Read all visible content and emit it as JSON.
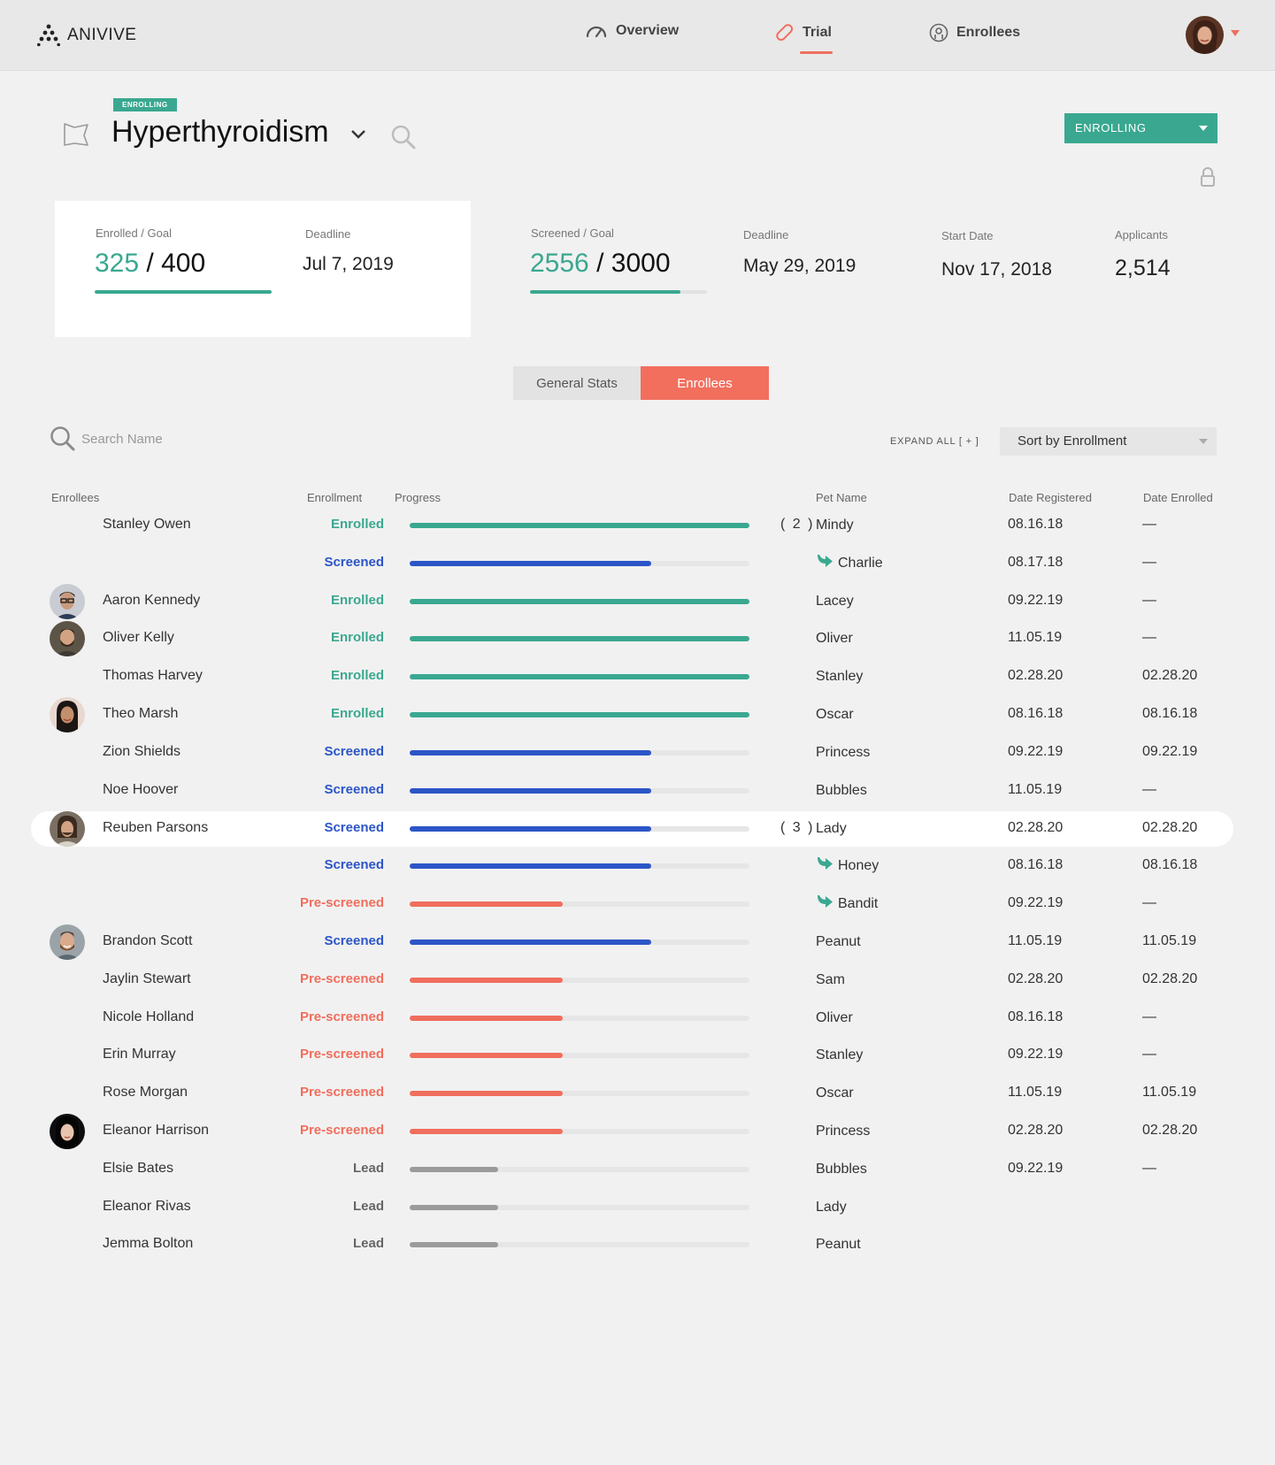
{
  "app": {
    "logo_text": "ANIVIVE"
  },
  "nav": {
    "overview": "Overview",
    "trial": "Trial",
    "enrollees": "Enrollees"
  },
  "trial": {
    "badge": "ENROLLING",
    "title": "Hyperthyroidism",
    "status_value": "ENROLLING"
  },
  "stats": {
    "enrolled_goal_label": "Enrolled / Goal",
    "enrolled": "325",
    "enrolled_goal": "400",
    "enrolled_fraction": 1.0,
    "deadline1_label": "Deadline",
    "deadline1": "Jul 7, 2019",
    "screened_goal_label": "Screened / Goal",
    "screened": "2556",
    "screened_goal": "3000",
    "screened_fraction": 0.85,
    "deadline2_label": "Deadline",
    "deadline2": "May 29, 2019",
    "start_label": "Start Date",
    "start": "Nov 17, 2018",
    "applicants_label": "Applicants",
    "applicants": "2,514"
  },
  "tabs": {
    "general": "General Stats",
    "enrollees": "Enrollees"
  },
  "toolbar": {
    "search_placeholder": "Search Name",
    "expand_all": "EXPAND ALL [ + ]",
    "sort_value": "Sort by Enrollment"
  },
  "columns": {
    "enrollees": "Enrollees",
    "enrollment": "Enrollment",
    "progress": "Progress",
    "pet": "Pet Name",
    "registered": "Date Registered",
    "enrolled": "Date Enrolled"
  },
  "colors": {
    "enrolled": "#3aa890",
    "screened": "#2c55c7",
    "prescreened": "#f06e5d",
    "lead": "#666666",
    "lead_bar": "#9b9b9b",
    "accent": "#f26f5e"
  },
  "rows": [
    {
      "name": "Stanley Owen",
      "status": "Enrolled",
      "progress": 1.0,
      "count": "( 2 )",
      "pet": "Mindy",
      "registered": "08.16.18",
      "enrolled": "—",
      "avatar": ""
    },
    {
      "name": "",
      "status": "Screened",
      "progress": 0.71,
      "count": "",
      "pet": "Charlie",
      "child": true,
      "registered": "08.17.18",
      "enrolled": "—",
      "avatar": ""
    },
    {
      "name": "Aaron Kennedy",
      "status": "Enrolled",
      "progress": 1.0,
      "count": "",
      "pet": "Lacey",
      "registered": "09.22.19",
      "enrolled": "—",
      "avatar": "man-glasses"
    },
    {
      "name": "Oliver Kelly",
      "status": "Enrolled",
      "progress": 1.0,
      "count": "",
      "pet": "Oliver",
      "registered": "11.05.19",
      "enrolled": "—",
      "avatar": "man-beard"
    },
    {
      "name": "Thomas Harvey",
      "status": "Enrolled",
      "progress": 1.0,
      "count": "",
      "pet": "Stanley",
      "registered": "02.28.20",
      "enrolled": "02.28.20",
      "avatar": ""
    },
    {
      "name": "Theo Marsh",
      "status": "Enrolled",
      "progress": 1.0,
      "count": "",
      "pet": "Oscar",
      "registered": "08.16.18",
      "enrolled": "08.16.18",
      "avatar": "woman-dark"
    },
    {
      "name": "Zion Shields",
      "status": "Screened",
      "progress": 0.71,
      "count": "",
      "pet": "Princess",
      "registered": "09.22.19",
      "enrolled": "09.22.19",
      "avatar": ""
    },
    {
      "name": "Noe Hoover",
      "status": "Screened",
      "progress": 0.71,
      "count": "",
      "pet": "Bubbles",
      "registered": "11.05.19",
      "enrolled": "—",
      "avatar": ""
    },
    {
      "name": "Reuben Parsons",
      "status": "Screened",
      "progress": 0.71,
      "count": "( 3 )",
      "pet": "Lady",
      "registered": "02.28.20",
      "enrolled": "02.28.20",
      "avatar": "man-hair",
      "highlight": true
    },
    {
      "name": "",
      "status": "Screened",
      "progress": 0.71,
      "count": "",
      "pet": "Honey",
      "child": true,
      "registered": "08.16.18",
      "enrolled": "08.16.18",
      "avatar": ""
    },
    {
      "name": "",
      "status": "Pre-screened",
      "progress": 0.45,
      "count": "",
      "pet": "Bandit",
      "child": true,
      "registered": "09.22.19",
      "enrolled": "—",
      "avatar": ""
    },
    {
      "name": "Brandon Scott",
      "status": "Screened",
      "progress": 0.71,
      "count": "",
      "pet": "Peanut",
      "registered": "11.05.19",
      "enrolled": "11.05.19",
      "avatar": "man-smile"
    },
    {
      "name": "Jaylin Stewart",
      "status": "Pre-screened",
      "progress": 0.45,
      "count": "",
      "pet": "Sam",
      "registered": "02.28.20",
      "enrolled": "02.28.20",
      "avatar": ""
    },
    {
      "name": "Nicole Holland",
      "status": "Pre-screened",
      "progress": 0.45,
      "count": "",
      "pet": "Oliver",
      "registered": "08.16.18",
      "enrolled": "—",
      "avatar": ""
    },
    {
      "name": "Erin Murray",
      "status": "Pre-screened",
      "progress": 0.45,
      "count": "",
      "pet": "Stanley",
      "registered": "09.22.19",
      "enrolled": "—",
      "avatar": ""
    },
    {
      "name": "Rose Morgan",
      "status": "Pre-screened",
      "progress": 0.45,
      "count": "",
      "pet": "Oscar",
      "registered": "11.05.19",
      "enrolled": "11.05.19",
      "avatar": ""
    },
    {
      "name": "Eleanor Harrison",
      "status": "Pre-screened",
      "progress": 0.45,
      "count": "",
      "pet": "Princess",
      "registered": "02.28.20",
      "enrolled": "02.28.20",
      "avatar": "woman-black-hair"
    },
    {
      "name": "Elsie Bates",
      "status": "Lead",
      "progress": 0.26,
      "count": "",
      "pet": "Bubbles",
      "registered": "09.22.19",
      "enrolled": "—",
      "avatar": ""
    },
    {
      "name": "Eleanor Rivas",
      "status": "Lead",
      "progress": 0.26,
      "count": "",
      "pet": "Lady",
      "registered": "",
      "enrolled": "",
      "avatar": ""
    },
    {
      "name": "Jemma Bolton",
      "status": "Lead",
      "progress": 0.26,
      "count": "",
      "pet": "Peanut",
      "registered": "",
      "enrolled": "",
      "avatar": ""
    }
  ]
}
